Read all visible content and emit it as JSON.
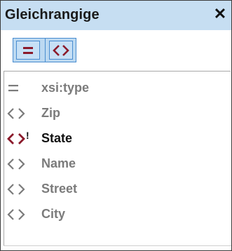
{
  "panel": {
    "title": "Gleichrangige",
    "close_glyph": "✕"
  },
  "toolbar": {
    "buttons": [
      {
        "name": "attributes-filter-button",
        "icon": "equals-icon",
        "color": "#8b1a2b"
      },
      {
        "name": "elements-filter-button",
        "icon": "element-brackets-icon",
        "color": "#8b1a2b"
      }
    ]
  },
  "items": [
    {
      "label": "xsi:type",
      "icon": "attribute-equals-icon",
      "state": "inactive"
    },
    {
      "label": "Zip",
      "icon": "element-icon",
      "state": "inactive"
    },
    {
      "label": "State",
      "icon": "element-required-icon",
      "state": "active",
      "marker": "!"
    },
    {
      "label": "Name",
      "icon": "element-icon",
      "state": "inactive"
    },
    {
      "label": "Street",
      "icon": "element-icon",
      "state": "inactive"
    },
    {
      "label": "City",
      "icon": "element-icon",
      "state": "inactive"
    }
  ],
  "colors": {
    "titlebar_bg": "#c6def2",
    "toolbar_bg": "#bcd9f1",
    "accent_dark_red": "#8b1a2b",
    "inactive_gray": "#7b7b7b",
    "active_text": "#111111"
  }
}
